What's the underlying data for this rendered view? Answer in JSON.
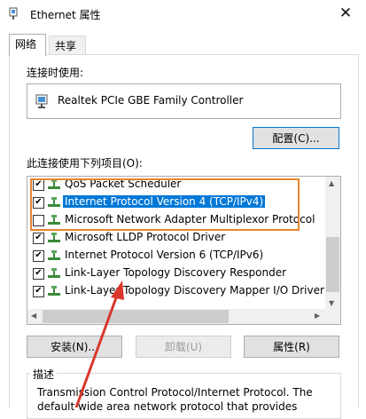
{
  "window": {
    "title": "Ethernet 属性",
    "close_glyph": "✕"
  },
  "tabs": [
    {
      "label": "网络",
      "active": true
    },
    {
      "label": "共享",
      "active": false
    }
  ],
  "connect_using": {
    "label": "连接时使用:",
    "adapter": "Realtek PCIe GBE Family Controller",
    "configure_button": "配置(C)..."
  },
  "items_section": {
    "label": "此连接使用下列项目(O):",
    "items": [
      {
        "label": "QoS Packet Scheduler",
        "checked": true,
        "selected": false
      },
      {
        "label": "Internet Protocol Version 4 (TCP/IPv4)",
        "checked": true,
        "selected": true
      },
      {
        "label": "Microsoft Network Adapter Multiplexor Protocol",
        "checked": false,
        "selected": false
      },
      {
        "label": "Microsoft LLDP Protocol Driver",
        "checked": true,
        "selected": false
      },
      {
        "label": "Internet Protocol Version 6 (TCP/IPv6)",
        "checked": true,
        "selected": false
      },
      {
        "label": "Link-Layer Topology Discovery Responder",
        "checked": true,
        "selected": false
      },
      {
        "label": "Link-Layer Topology Discovery Mapper I/O Driver",
        "checked": true,
        "selected": false
      }
    ]
  },
  "buttons": {
    "install": "安装(N)...",
    "uninstall": "卸载(U)",
    "properties": "属性(R)"
  },
  "description": {
    "title": "描述",
    "text": "Transmission Control Protocol/Internet Protocol. The default wide area network protocol that provides"
  },
  "colors": {
    "highlight_box": "#e8862e",
    "annotation_arrow": "#d9382b",
    "selection": "#0078d7"
  },
  "icons": {
    "title": "network-adapter-icon",
    "adapter": "network-card-icon",
    "item": "network-protocol-icon"
  }
}
